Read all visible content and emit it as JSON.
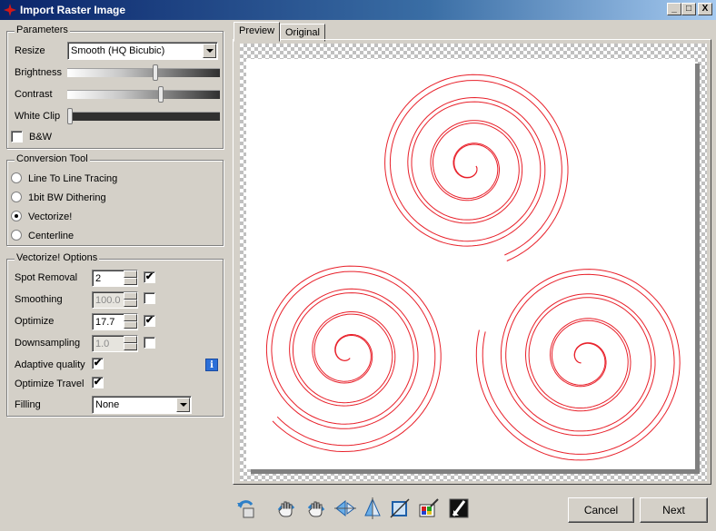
{
  "window": {
    "title": "Import Raster Image",
    "controls": {
      "minimize": "_",
      "maximize": "□",
      "close": "X"
    }
  },
  "parameters": {
    "legend": "Parameters",
    "resize_label": "Resize",
    "resize_value": "Smooth (HQ Bicubic)",
    "brightness_label": "Brightness",
    "brightness_level": 0.58,
    "contrast_label": "Contrast",
    "contrast_level": 0.62,
    "white_clip_label": "White Clip",
    "white_clip_level": 0.0,
    "bw_label": "B&W",
    "bw_checked": false
  },
  "conversion_tool": {
    "legend": "Conversion Tool",
    "options": [
      {
        "label": "Line To Line Tracing",
        "selected": false
      },
      {
        "label": "1bit BW Dithering",
        "selected": false
      },
      {
        "label": "Vectorize!",
        "selected": true
      },
      {
        "label": "Centerline",
        "selected": false
      }
    ]
  },
  "vectorize_options": {
    "legend": "Vectorize! Options",
    "spot_removal_label": "Spot Removal",
    "spot_removal_value": "2",
    "smoothing_label": "Smoothing",
    "smoothing_value": "100.0",
    "optimize_label": "Optimize",
    "optimize_value": "17.7",
    "downsampling_label": "Downsampling",
    "downsampling_value": "1.0",
    "adaptive_quality_label": "Adaptive quality",
    "optimize_travel_label": "Optimize Travel",
    "filling_label": "Filling",
    "filling_value": "None",
    "check_mark": "✔"
  },
  "tabs": {
    "preview": "Preview",
    "original": "Original"
  },
  "info_glyph": "i",
  "toolbar_icons": [
    "rotate-icon",
    "hand-left-icon",
    "hand-right-icon",
    "mirror-horizontal-icon",
    "mirror-vertical-icon",
    "crop-icon",
    "color-picker-icon",
    "invert-icon"
  ],
  "buttons": {
    "cancel": "Cancel",
    "next": "Next"
  },
  "colors": {
    "trace_line": "#e8202a",
    "titlebar": "#0a246a"
  }
}
